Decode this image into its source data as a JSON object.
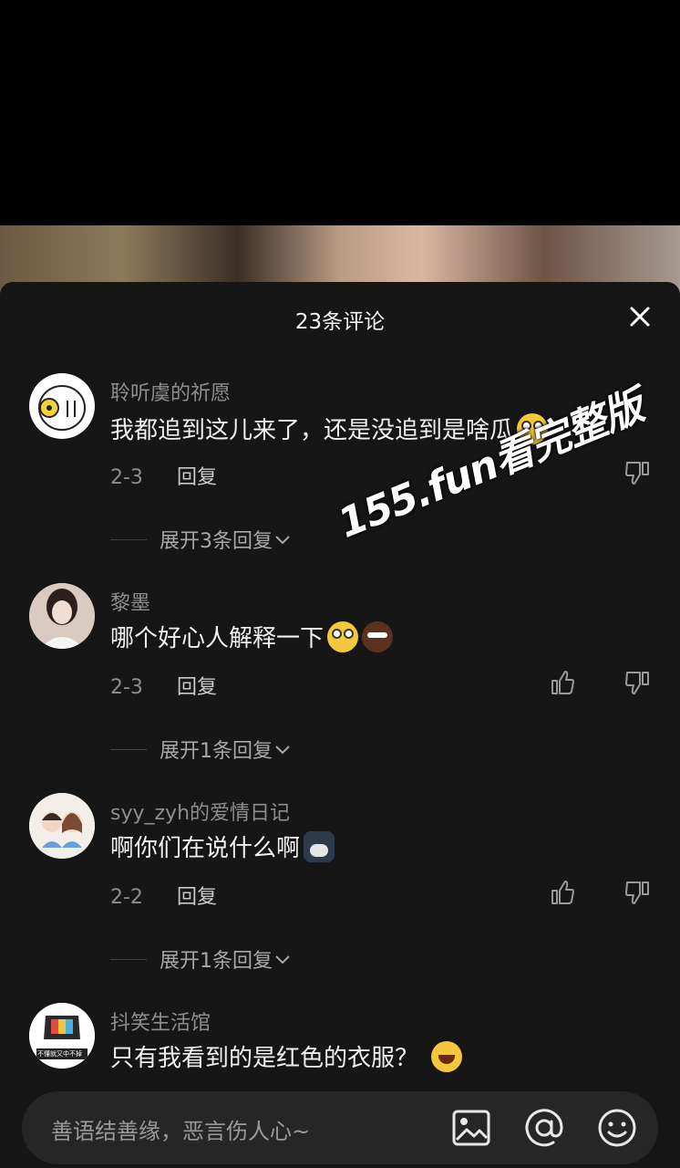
{
  "sheet": {
    "title": "23条评论"
  },
  "comments": [
    {
      "username": "聆听虞的祈愿",
      "text": "我都追到这儿来了，还是没追到是啥瓜",
      "date": "2-3",
      "reply_label": "回复",
      "expand_label": "展开3条回复",
      "emojis": [
        "stare-emoji"
      ],
      "has_like": false
    },
    {
      "username": "黎墨",
      "text": "哪个好心人解释一下",
      "date": "2-3",
      "reply_label": "回复",
      "expand_label": "展开1条回复",
      "emojis": [
        "stare-emoji",
        "brown-smirk-emoji"
      ],
      "has_like": true
    },
    {
      "username": "syy_zyh的爱情日记",
      "text": "啊你们在说什么啊",
      "date": "2-2",
      "reply_label": "回复",
      "expand_label": "展开1条回复",
      "emojis": [
        "husky-emoji"
      ],
      "has_like": true
    },
    {
      "username": "抖笑生活馆",
      "text": "只有我看到的是红色的衣服？",
      "emojis": [
        "laugh-cry-emoji"
      ]
    }
  ],
  "avatar4_text": "不懂就又中不掉",
  "watermark": "155.fun看完整版",
  "input": {
    "placeholder": "善语结善缘，恶言伤人心~"
  },
  "icons": {
    "close": "close-icon",
    "like": "thumbs-up-icon",
    "dislike": "thumbs-down-icon",
    "chevron": "chevron-down-icon",
    "image": "image-icon",
    "mention": "at-icon",
    "emoji": "smiley-icon"
  },
  "colors": {
    "sheet_bg": "#161616",
    "muted_text": "#8d8d8d",
    "body_text": "#f0f0f0",
    "input_bg": "#262626"
  }
}
